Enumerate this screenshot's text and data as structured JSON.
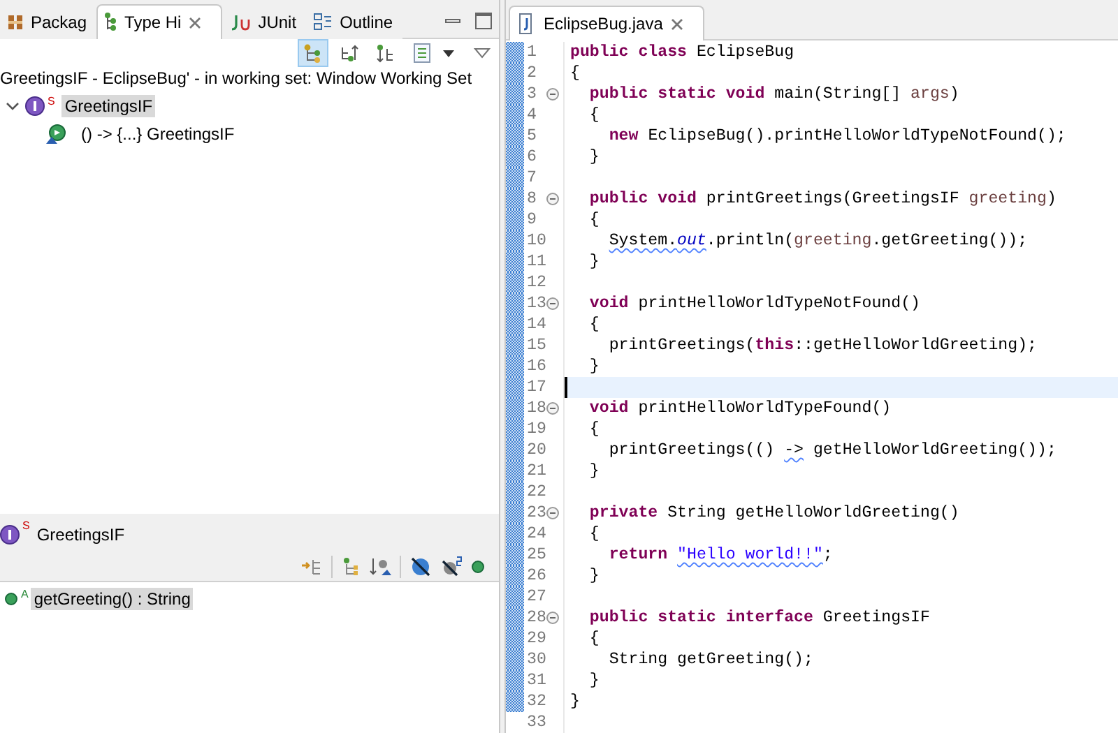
{
  "left_tabs": [
    {
      "label": "Packag",
      "kind": "package",
      "selected": false,
      "closable": false
    },
    {
      "label": "Type Hi",
      "kind": "hierarchy",
      "selected": true,
      "closable": true
    },
    {
      "label": "JUnit",
      "kind": "junit",
      "selected": false,
      "closable": false
    },
    {
      "label": "Outline",
      "kind": "outline",
      "selected": false,
      "closable": false
    }
  ],
  "hierarchy_toolbar": [
    {
      "kind": "type-hierarchy",
      "selected": true
    },
    {
      "kind": "supertype",
      "selected": false
    },
    {
      "kind": "subtype",
      "selected": false
    },
    {
      "kind": "layout",
      "selected": false
    }
  ],
  "hierarchy_title": "GreetingsIF - EclipseBug' - in working set: Window Working Set",
  "tree": [
    {
      "label": "GreetingsIF",
      "badge": "S",
      "kind": "interface",
      "expanded": true,
      "selected": true,
      "children": [
        {
          "label": "() -> {...} GreetingsIF",
          "kind": "lambda",
          "selected": false
        }
      ]
    }
  ],
  "member_panel": {
    "type_label": "GreetingsIF",
    "badge": "S",
    "members": [
      {
        "label": "getGreeting() : String",
        "badge": "A",
        "selected": true
      }
    ]
  },
  "editor_tab": {
    "label": "EclipseBug.java"
  },
  "code": [
    {
      "number": "1",
      "foldable": false,
      "current": false,
      "tokens": [
        {
          "text": "public class",
          "kind": "kw"
        },
        {
          "text": " EclipseBug",
          "kind": "plain"
        }
      ]
    },
    {
      "number": "2",
      "foldable": false,
      "current": false,
      "tokens": [
        {
          "text": "{",
          "kind": "plain"
        }
      ]
    },
    {
      "number": "3",
      "foldable": true,
      "current": false,
      "tokens": [
        {
          "text": "  public static void",
          "kind": "kw"
        },
        {
          "text": " main(String[] ",
          "kind": "plain"
        },
        {
          "text": "args",
          "kind": "param"
        },
        {
          "text": ")",
          "kind": "plain"
        }
      ]
    },
    {
      "number": "4",
      "foldable": false,
      "current": false,
      "tokens": [
        {
          "text": "  {",
          "kind": "plain"
        }
      ]
    },
    {
      "number": "5",
      "foldable": false,
      "current": false,
      "tokens": [
        {
          "text": "    new",
          "kind": "kw"
        },
        {
          "text": " EclipseBug().printHelloWorldTypeNotFound();",
          "kind": "plain"
        }
      ]
    },
    {
      "number": "6",
      "foldable": false,
      "current": false,
      "tokens": [
        {
          "text": "  }",
          "kind": "plain"
        }
      ]
    },
    {
      "number": "7",
      "foldable": false,
      "current": false
    },
    {
      "number": "8",
      "foldable": true,
      "current": false,
      "tokens": [
        {
          "text": "  public void",
          "kind": "kw"
        },
        {
          "text": " printGreetings(GreetingsIF ",
          "kind": "plain"
        },
        {
          "text": "greeting",
          "kind": "param"
        },
        {
          "text": ")",
          "kind": "plain"
        }
      ]
    },
    {
      "number": "9",
      "foldable": false,
      "current": false,
      "tokens": [
        {
          "text": "  {",
          "kind": "plain"
        }
      ]
    },
    {
      "number": "10",
      "foldable": false,
      "current": false,
      "tokens": [
        {
          "text": "    System.",
          "kind": "plain",
          "squiggle": true
        },
        {
          "text": "out",
          "kind": "field",
          "squiggle": true
        },
        {
          "text": ".println(",
          "kind": "plain"
        },
        {
          "text": "greeting",
          "kind": "param"
        },
        {
          "text": ".getGreeting());",
          "kind": "plain"
        }
      ]
    },
    {
      "number": "11",
      "foldable": false,
      "current": false,
      "tokens": [
        {
          "text": "  }",
          "kind": "plain"
        }
      ]
    },
    {
      "number": "12",
      "foldable": false,
      "current": false
    },
    {
      "number": "13",
      "foldable": true,
      "current": false,
      "tokens": [
        {
          "text": "  void",
          "kind": "kw"
        },
        {
          "text": " printHelloWorldTypeNotFound()",
          "kind": "plain"
        }
      ]
    },
    {
      "number": "14",
      "foldable": false,
      "current": false,
      "tokens": [
        {
          "text": "  {",
          "kind": "plain"
        }
      ]
    },
    {
      "number": "15",
      "foldable": false,
      "current": false,
      "tokens": [
        {
          "text": "    printGreetings(",
          "kind": "plain"
        },
        {
          "text": "this",
          "kind": "kw"
        },
        {
          "text": "::getHelloWorldGreeting);",
          "kind": "plain"
        }
      ]
    },
    {
      "number": "16",
      "foldable": false,
      "current": false,
      "tokens": [
        {
          "text": "  }",
          "kind": "plain"
        }
      ]
    },
    {
      "number": "17",
      "foldable": false,
      "current": true
    },
    {
      "number": "18",
      "foldable": true,
      "current": false,
      "tokens": [
        {
          "text": "  void",
          "kind": "kw"
        },
        {
          "text": " printHelloWorldTypeFound()",
          "kind": "plain"
        }
      ]
    },
    {
      "number": "19",
      "foldable": false,
      "current": false,
      "tokens": [
        {
          "text": "  {",
          "kind": "plain"
        }
      ]
    },
    {
      "number": "20",
      "foldable": false,
      "current": false,
      "tokens": [
        {
          "text": "    printGreetings(() ",
          "kind": "plain"
        },
        {
          "text": "->",
          "kind": "plain",
          "squiggle": true
        },
        {
          "text": " getHelloWorldGreeting());",
          "kind": "plain"
        }
      ]
    },
    {
      "number": "21",
      "foldable": false,
      "current": false,
      "tokens": [
        {
          "text": "  }",
          "kind": "plain"
        }
      ]
    },
    {
      "number": "22",
      "foldable": false,
      "current": false
    },
    {
      "number": "23",
      "foldable": true,
      "current": false,
      "tokens": [
        {
          "text": "  private",
          "kind": "kw"
        },
        {
          "text": " String getHelloWorldGreeting()",
          "kind": "plain"
        }
      ]
    },
    {
      "number": "24",
      "foldable": false,
      "current": false,
      "tokens": [
        {
          "text": "  {",
          "kind": "plain"
        }
      ]
    },
    {
      "number": "25",
      "foldable": false,
      "current": false,
      "tokens": [
        {
          "text": "    return ",
          "kind": "kw"
        },
        {
          "text": "\"Hello world!!\"",
          "kind": "str",
          "squiggle": true
        },
        {
          "text": ";",
          "kind": "plain"
        }
      ]
    },
    {
      "number": "26",
      "foldable": false,
      "current": false,
      "tokens": [
        {
          "text": "  }",
          "kind": "plain"
        }
      ]
    },
    {
      "number": "27",
      "foldable": false,
      "current": false
    },
    {
      "number": "28",
      "foldable": true,
      "current": false,
      "tokens": [
        {
          "text": "  public static interface",
          "kind": "kw"
        },
        {
          "text": " GreetingsIF",
          "kind": "plain"
        }
      ]
    },
    {
      "number": "29",
      "foldable": false,
      "current": false,
      "tokens": [
        {
          "text": "  {",
          "kind": "plain"
        }
      ]
    },
    {
      "number": "30",
      "foldable": false,
      "current": false,
      "tokens": [
        {
          "text": "    String getGreeting();",
          "kind": "plain"
        }
      ]
    },
    {
      "number": "31",
      "foldable": false,
      "current": false,
      "tokens": [
        {
          "text": "  }",
          "kind": "plain"
        }
      ]
    },
    {
      "number": "32",
      "foldable": false,
      "current": false,
      "tokens": [
        {
          "text": "}",
          "kind": "plain"
        }
      ]
    },
    {
      "number": "33",
      "foldable": false,
      "current": false
    }
  ]
}
